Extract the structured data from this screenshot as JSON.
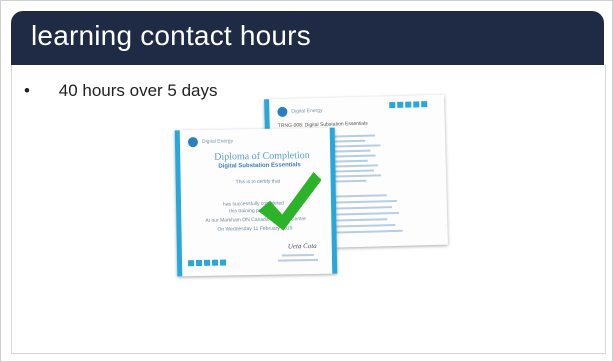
{
  "slide": {
    "title": "learning contact hours",
    "bullets": [
      {
        "symbol": "•",
        "text": "40 hours over 5 days"
      }
    ]
  },
  "colors": {
    "title_bar": "#1f2a44",
    "accent": "#2aa7d9",
    "check": "#2db329"
  },
  "certificate_front": {
    "brand": "Digital Energy",
    "title": "Diploma of Completion",
    "subtitle": "Digital Substation Essentials",
    "certify_text": "This is to certify that",
    "line_a": "has successfully completed",
    "line_b": "this training program",
    "location": "At our Markham ON Canada Learning Centre",
    "date": "On Wednesday 11 February 2015"
  },
  "certificate_back": {
    "brand": "Digital Energy",
    "title": "TRNG-008: Digital Substation Essentials"
  },
  "icons": [
    "ge-logo-icon",
    "checkmark-icon"
  ]
}
